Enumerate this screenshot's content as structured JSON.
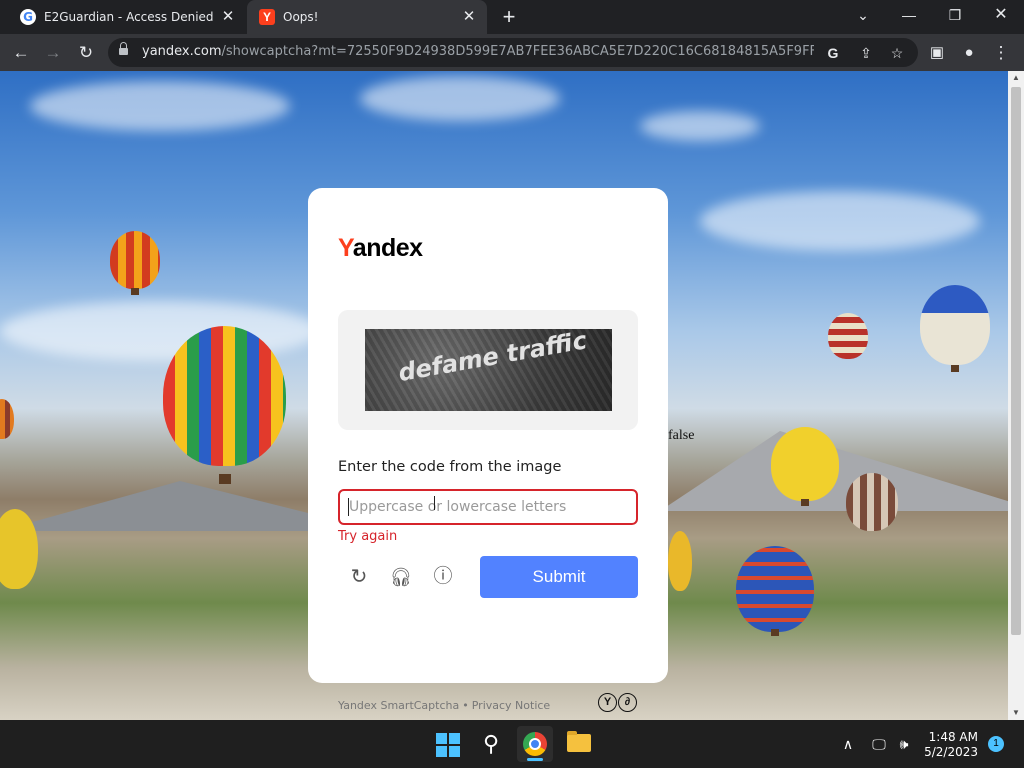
{
  "browser": {
    "tabs": [
      {
        "title": "E2Guardian - Access Denied",
        "favicon": "google-g-icon"
      },
      {
        "title": "Oops!",
        "favicon": "yandex-y-icon"
      }
    ],
    "url_host": "yandex.com",
    "url_path": "/showcaptcha?mt=72550F9D24938D599E7AB7FEE36ABCA5E7D220C16C68184815A5F9FF4190..."
  },
  "page": {
    "stray_text": "false",
    "card": {
      "logo_y": "Y",
      "logo_rest": "andex",
      "captcha_text": "defame traffic",
      "prompt": "Enter the code from the image",
      "input_placeholder": "Uppercase or lowercase letters",
      "error": "Try again",
      "submit_label": "Submit",
      "footer_brand": "Yandex SmartCaptcha",
      "footer_separator": "•",
      "footer_privacy": "Privacy Notice"
    }
  },
  "taskbar": {
    "time": "1:48 AM",
    "date": "5/2/2023",
    "notification_count": "1"
  },
  "colors": {
    "brand_red": "#fc3f1d",
    "error_red": "#d6242b",
    "submit_blue": "#5282ff"
  }
}
